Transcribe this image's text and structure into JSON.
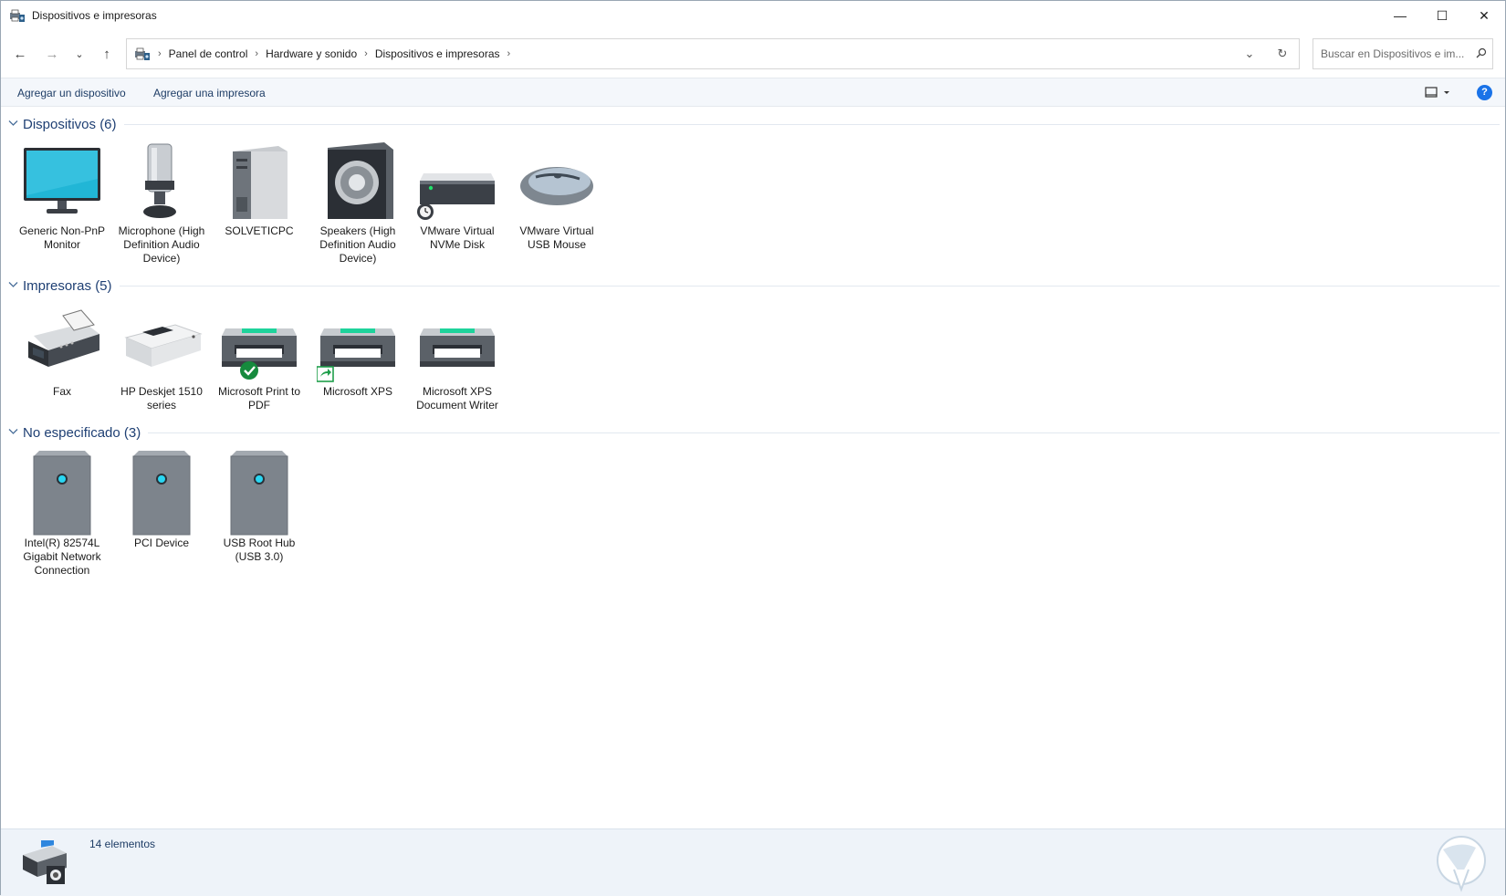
{
  "window": {
    "title": "Dispositivos e impresoras",
    "minimize_glyph": "—",
    "maximize_glyph": "☐",
    "close_glyph": "✕"
  },
  "nav": {
    "back_glyph": "←",
    "forward_glyph": "→",
    "recent_glyph": "⌄",
    "up_glyph": "↑",
    "breadcrumb": [
      "Panel de control",
      "Hardware y sonido",
      "Dispositivos e impresoras"
    ],
    "sep_glyph": "›",
    "dropdown_glyph": "⌄",
    "refresh_glyph": "↻",
    "search_placeholder": "Buscar en Dispositivos e im...",
    "search_glyph": "⌕"
  },
  "commands": {
    "add_device": "Agregar un dispositivo",
    "add_printer": "Agregar una impresora",
    "view_glyph": "▭ ▾",
    "help_glyph": "?"
  },
  "groups": {
    "devices": {
      "title": "Dispositivos (6)",
      "items": [
        {
          "label": "Generic Non-PnP Monitor",
          "icon": "monitor-icon"
        },
        {
          "label": "Microphone (High Definition Audio Device)",
          "icon": "microphone-icon"
        },
        {
          "label": "SOLVETICPC",
          "icon": "computer-tower-icon"
        },
        {
          "label": "Speakers (High Definition Audio Device)",
          "icon": "speaker-icon"
        },
        {
          "label": "VMware Virtual NVMe Disk",
          "icon": "disk-drive-icon"
        },
        {
          "label": "VMware Virtual USB Mouse",
          "icon": "mouse-icon"
        }
      ]
    },
    "printers": {
      "title": "Impresoras (5)",
      "items": [
        {
          "label": "Fax",
          "icon": "fax-icon"
        },
        {
          "label": "HP Deskjet 1510 series",
          "icon": "inkjet-printer-icon"
        },
        {
          "label": "Microsoft Print to PDF",
          "icon": "printer-icon",
          "badge": "default-check"
        },
        {
          "label": "Microsoft XPS",
          "icon": "printer-icon",
          "badge": "shared-arrow"
        },
        {
          "label": "Microsoft XPS Document Writer",
          "icon": "printer-icon"
        }
      ]
    },
    "unspecified": {
      "title": "No especificado (3)",
      "items": [
        {
          "label": "Intel(R) 82574L Gigabit Network Connection",
          "icon": "generic-device-box-icon"
        },
        {
          "label": "PCI Device",
          "icon": "generic-device-box-icon"
        },
        {
          "label": "USB Root Hub (USB 3.0)",
          "icon": "generic-device-box-icon"
        }
      ]
    }
  },
  "status": {
    "count_text": "14 elementos"
  },
  "colors": {
    "link_blue": "#1e3f73",
    "accent": "#1a73e8",
    "status_bg": "#eef3f9"
  }
}
